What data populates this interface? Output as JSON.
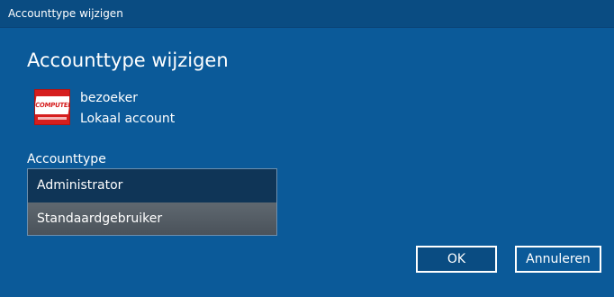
{
  "window": {
    "title": "Accounttype wijzigen"
  },
  "page": {
    "heading": "Accounttype wijzigen"
  },
  "account": {
    "avatar_logo_text": "COMPUTER!",
    "name": "bezoeker",
    "type": "Lokaal account"
  },
  "account_type_field": {
    "label": "Accounttype",
    "options": [
      {
        "label": "Administrator"
      },
      {
        "label": "Standaardgebruiker",
        "highlighted": true
      }
    ]
  },
  "buttons": {
    "ok_label": "OK",
    "cancel_label": "Annuleren"
  },
  "colors": {
    "background": "#0b5a99",
    "titlebar": "#0a4c82",
    "dropdown_bg": "#0f3557",
    "highlighted_option": "#5a636b",
    "text": "#ffffff"
  }
}
